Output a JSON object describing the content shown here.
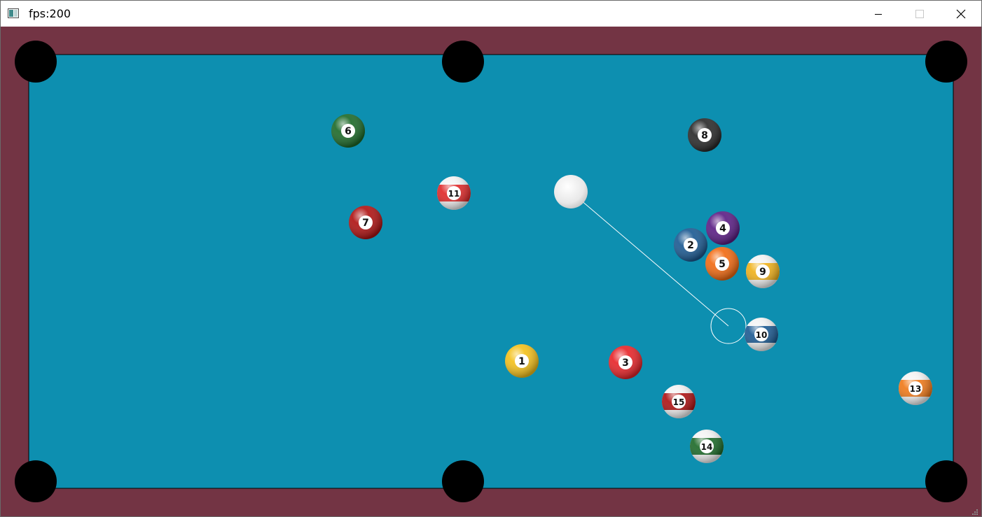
{
  "window": {
    "title": "fps:200",
    "controls": [
      "minimize",
      "maximize",
      "close"
    ]
  },
  "colors": {
    "rail": "#733444",
    "felt": "#0d8fb0",
    "pocket": "#000000",
    "cue_ball": "#eeeeee",
    "aim_line": "#ffffff"
  },
  "icons": {
    "app": "window-app-icon",
    "minimize": "minimize-icon",
    "maximize": "maximize-icon",
    "close": "close-icon",
    "resize": "resize-grip-icon"
  },
  "balls": [
    {
      "label": "6",
      "color": "#1e6b2a",
      "stripe": false
    },
    {
      "label": "8",
      "color": "#2b2b2b",
      "stripe": false
    },
    {
      "label": "11",
      "color": "#e02a2a",
      "stripe": true
    },
    {
      "label": "7",
      "color": "#b01414",
      "stripe": false
    },
    {
      "label": "4",
      "color": "#5c1f86",
      "stripe": false
    },
    {
      "label": "2",
      "color": "#1d5b93",
      "stripe": false
    },
    {
      "label": "5",
      "color": "#f26b13",
      "stripe": false
    },
    {
      "label": "9",
      "color": "#f0b21c",
      "stripe": true
    },
    {
      "label": "10",
      "color": "#1d5b93",
      "stripe": true
    },
    {
      "label": "1",
      "color": "#f4c11c",
      "stripe": false
    },
    {
      "label": "3",
      "color": "#e8262a",
      "stripe": false
    },
    {
      "label": "15",
      "color": "#b01414",
      "stripe": true
    },
    {
      "label": "14",
      "color": "#1e6b2a",
      "stripe": true
    },
    {
      "label": "13",
      "color": "#f07a1a",
      "stripe": true
    }
  ]
}
